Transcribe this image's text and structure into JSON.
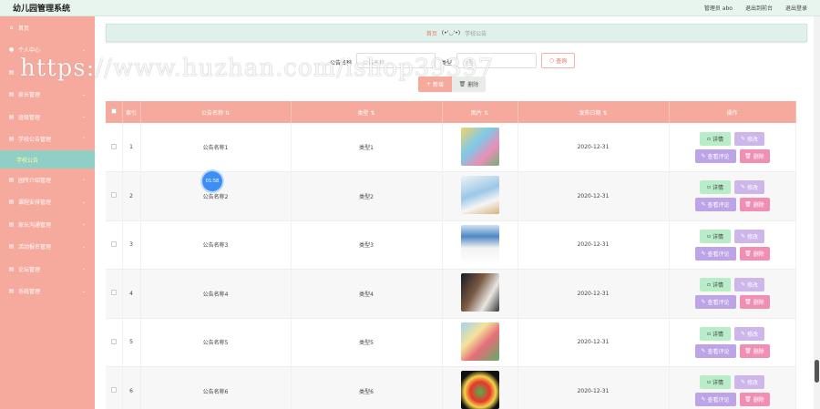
{
  "header": {
    "title": "幼儿园管理系统",
    "user_label": "管理员 abo",
    "to_front": "退出到前台",
    "logout": "退出登录"
  },
  "sidebar": {
    "items": [
      {
        "label": "首页",
        "icon": "home-icon"
      },
      {
        "label": "个人中心",
        "icon": "user-icon"
      },
      {
        "label": "",
        "icon": "list-icon"
      },
      {
        "label": "家长管理",
        "icon": "list-icon"
      },
      {
        "label": "班级管理",
        "icon": "list-icon"
      },
      {
        "label": "学校公告管理",
        "icon": "list-icon",
        "active": true
      },
      {
        "label": "园所介绍管理",
        "icon": "list-icon"
      },
      {
        "label": "课程安排管理",
        "icon": "list-icon"
      },
      {
        "label": "家长沟通管理",
        "icon": "list-icon"
      },
      {
        "label": "活动报名管理",
        "icon": "list-icon"
      },
      {
        "label": "论坛管理",
        "icon": "list-icon"
      },
      {
        "label": "系统管理",
        "icon": "list-icon"
      }
    ],
    "active_sub": "学校公告"
  },
  "breadcrumb": {
    "home": "首页",
    "separator": "(•'◡'•)",
    "current": "学校公告"
  },
  "search": {
    "name_label": "公告名称",
    "name_placeholder": "公告名称",
    "type_label": "类型",
    "type_placeholder": "类型",
    "query_button": "查询"
  },
  "toolbar": {
    "add": "新增",
    "delete": "删除"
  },
  "table": {
    "columns": [
      "索引",
      "公告名称",
      "类型",
      "图片",
      "发布日期",
      "操作"
    ],
    "rows": [
      {
        "index": "1",
        "name": "公告名称1",
        "type": "类型1",
        "date": "2020-12-31"
      },
      {
        "index": "2",
        "name": "公告名称2",
        "type": "类型2",
        "date": "2020-12-31"
      },
      {
        "index": "3",
        "name": "公告名称3",
        "type": "类型3",
        "date": "2020-12-31"
      },
      {
        "index": "4",
        "name": "公告名称4",
        "type": "类型4",
        "date": "2020-12-31"
      },
      {
        "index": "5",
        "name": "公告名称5",
        "type": "类型5",
        "date": "2020-12-31"
      },
      {
        "index": "6",
        "name": "公告名称6",
        "type": "类型6",
        "date": "2020-12-31"
      }
    ],
    "ops": {
      "detail": "详情",
      "edit": "修改",
      "comments": "查看评论",
      "remove": "删除"
    }
  },
  "overlay": {
    "timer": "01:58",
    "watermark": "https://www.huzhan.com/ishop39397"
  },
  "colors": {
    "sidebar": "#f6a99d",
    "active_sub": "#8fcfc6",
    "header": "#e8f5ee"
  }
}
